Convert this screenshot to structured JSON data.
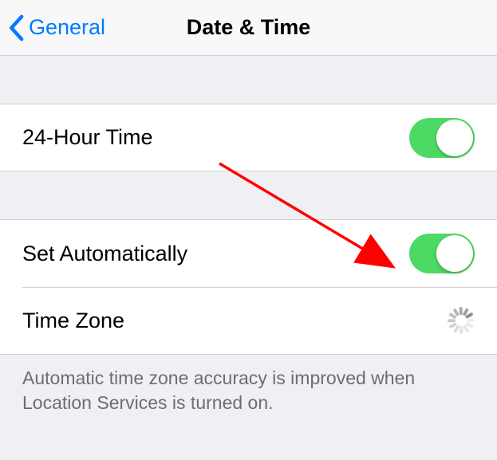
{
  "navbar": {
    "back_label": "General",
    "title": "Date & Time"
  },
  "rows": {
    "twenty_four_hour": {
      "label": "24-Hour Time",
      "on": true
    },
    "set_automatically": {
      "label": "Set Automatically",
      "on": true
    },
    "time_zone": {
      "label": "Time Zone",
      "loading": true
    }
  },
  "footer_text": "Automatic time zone accuracy is improved when Location Services is turned on.",
  "colors": {
    "tint": "#007aff",
    "toggle_on": "#4cd964",
    "annotation": "#ff0000"
  }
}
